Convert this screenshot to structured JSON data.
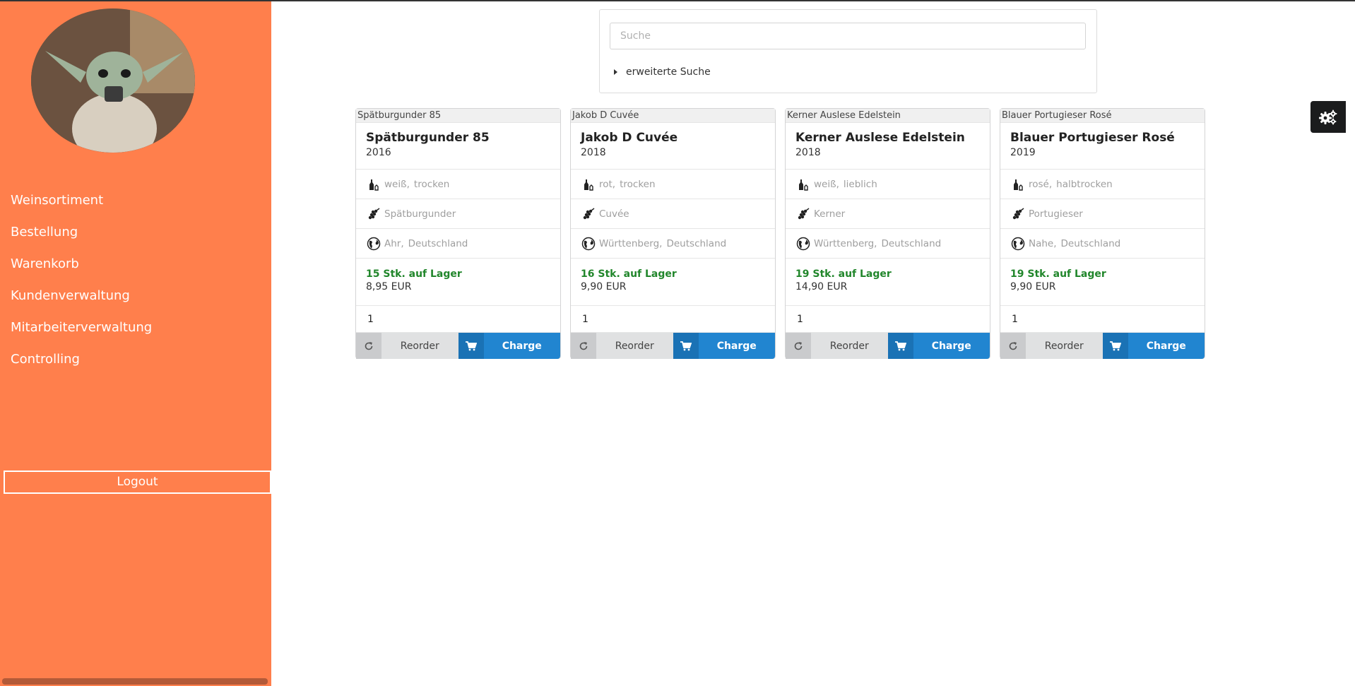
{
  "sidebar": {
    "nav": [
      {
        "label": "Weinsortiment"
      },
      {
        "label": "Bestellung"
      },
      {
        "label": "Warenkorb"
      },
      {
        "label": "Kundenverwaltung"
      },
      {
        "label": "Mitarbeiterverwaltung"
      },
      {
        "label": "Controlling"
      }
    ],
    "logout_label": "Logout"
  },
  "search": {
    "placeholder": "Suche",
    "value": "",
    "advanced_label": "erweiterte Suche"
  },
  "settings_icon": "cogs-icon",
  "wines": [
    {
      "img_alt": "Spätburgunder 85",
      "name": "Spätburgunder 85",
      "year": "2016",
      "color": "weiß,",
      "taste": "trocken",
      "grape": "Spätburgunder",
      "region": "Ahr,",
      "country": "Deutschland",
      "stock": "15 Stk. auf Lager",
      "price": "8,95 EUR",
      "qty": "1"
    },
    {
      "img_alt": "Jakob D Cuvée",
      "name": "Jakob D Cuvée",
      "year": "2018",
      "color": "rot,",
      "taste": "trocken",
      "grape": "Cuvée",
      "region": "Württenberg,",
      "country": "Deutschland",
      "stock": "16 Stk. auf Lager",
      "price": "9,90 EUR",
      "qty": "1"
    },
    {
      "img_alt": "Kerner Auslese Edelstein",
      "name": "Kerner Auslese Edelstein",
      "year": "2018",
      "color": "weiß,",
      "taste": "lieblich",
      "grape": "Kerner",
      "region": "Württenberg,",
      "country": "Deutschland",
      "stock": "19 Stk. auf Lager",
      "price": "14,90 EUR",
      "qty": "1"
    },
    {
      "img_alt": "Blauer Portugieser Rosé",
      "name": "Blauer Portugieser Rosé",
      "year": "2019",
      "color": "rosé,",
      "taste": "halbtrocken",
      "grape": "Portugieser",
      "region": "Nahe,",
      "country": "Deutschland",
      "stock": "19 Stk. auf Lager",
      "price": "9,90 EUR",
      "qty": "1"
    }
  ],
  "buttons": {
    "reorder_label": "Reorder",
    "charge_label": "Charge"
  },
  "colors": {
    "sidebar": "#ff7f4c",
    "charge": "#2185d0",
    "stock": "#21862b"
  }
}
